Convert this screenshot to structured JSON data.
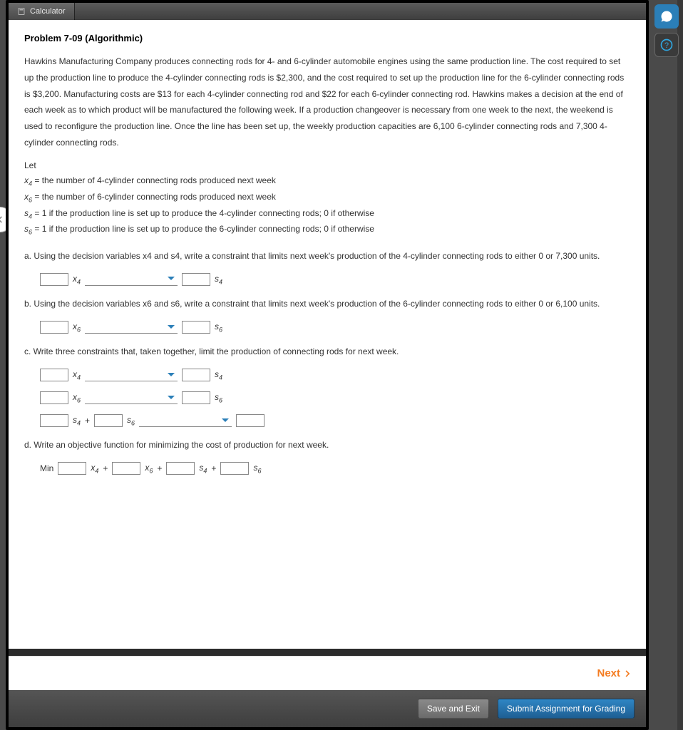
{
  "tab": {
    "label": "Calculator"
  },
  "floats": {
    "chat": "chat-icon",
    "help": "help-icon"
  },
  "problem": {
    "title": "Problem 7-09 (Algorithmic)",
    "paragraph": "Hawkins Manufacturing Company produces connecting rods for 4- and 6-cylinder automobile engines using the same production line. The cost required to set up the production line to produce the 4-cylinder connecting rods is $2,300, and the cost required to set up the production line for the 6-cylinder connecting rods is $3,200. Manufacturing costs are $13 for each 4-cylinder connecting rod and $22 for each 6-cylinder connecting rod. Hawkins makes a decision at the end of each week as to which product will be manufactured the following week. If a production changeover is necessary from one week to the next, the weekend is used to reconfigure the production line. Once the line has been set up, the weekly production capacities are 6,100 6-cylinder connecting rods and 7,300 4-cylinder connecting rods.",
    "let": "Let",
    "defs": {
      "x4": "= the number of 4-cylinder connecting rods produced next week",
      "x6": "= the number of 6-cylinder connecting rods produced next week",
      "s4": "= 1 if the production line is set up to produce the 4-cylinder connecting rods; 0 if otherwise",
      "s6": "= 1 if the production line is set up to produce the 6-cylinder connecting rods; 0 if otherwise"
    },
    "vars": {
      "x4": "x",
      "x4sub": "4",
      "x6": "x",
      "x6sub": "6",
      "s4": "s",
      "s4sub": "4",
      "s6": "s",
      "s6sub": "6"
    },
    "qa": {
      "a": "a. Using the decision variables x4 and s4, write a constraint that limits next week's production of the 4-cylinder connecting rods to either 0 or 7,300 units.",
      "b": "b. Using the decision variables x6 and s6, write a constraint that limits next week's production of the 6-cylinder connecting rods to either 0 or 6,100 units.",
      "c": "c. Write three constraints that, taken together, limit the production of connecting rods for next week.",
      "d": "d. Write an objective function for minimizing the cost of production for next week."
    },
    "misc": {
      "plus": "+",
      "min": "Min"
    }
  },
  "footer": {
    "next": "Next",
    "save": "Save and Exit",
    "submit": "Submit Assignment for Grading"
  }
}
